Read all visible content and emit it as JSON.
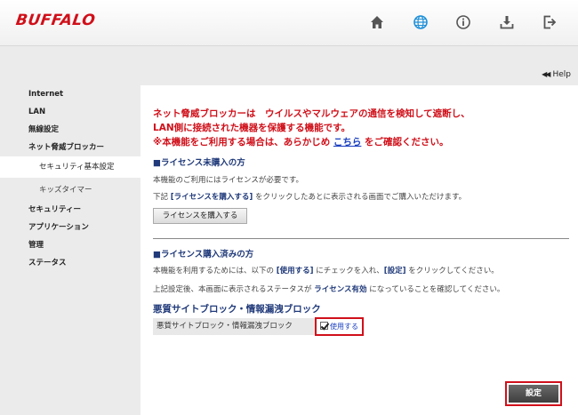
{
  "header": {
    "logo": "BUFFALO",
    "icons": [
      "home-icon",
      "globe-icon",
      "info-icon",
      "download-icon",
      "logout-icon"
    ],
    "help_label": "Help"
  },
  "sidebar": {
    "items": [
      {
        "label": "Internet"
      },
      {
        "label": "LAN"
      },
      {
        "label": "無線設定"
      },
      {
        "label": "ネット脅威ブロッカー"
      },
      {
        "label": "セキュリティ基本設定"
      },
      {
        "label": "キッズタイマー"
      },
      {
        "label": "セキュリティー"
      },
      {
        "label": "アプリケーション"
      },
      {
        "label": "管理"
      },
      {
        "label": "ステータス"
      }
    ]
  },
  "main": {
    "warning_line1": "ネット脅威ブロッカーは　ウイルスやマルウェアの通信を検知して遮断し、",
    "warning_line2": "LAN側に接続された機器を保護する機能です。",
    "warning_line3_pre": "※本機能をご利用する場合は、あらかじめ ",
    "warning_link": "こちら",
    "warning_line3_post": " をご確認ください。",
    "unpurchased_title": "■ライセンス未購入の方",
    "unpurchased_text1": "本機能のご利用にはライセンスが必要です。",
    "unpurchased_text2_pre": "下記 ",
    "unpurchased_text2_bold": "[ライセンスを購入する]",
    "unpurchased_text2_post": " をクリックしたあとに表示される画面でご購入いただけます。",
    "buy_button": "ライセンスを購入する",
    "purchased_title": "■ライセンス購入済みの方",
    "purchased_text1_pre": "本機能を利用するためには、以下の ",
    "purchased_text1_bold1": "[使用する]",
    "purchased_text1_mid": " にチェックを入れ、",
    "purchased_text1_bold2": "[設定]",
    "purchased_text1_post": " をクリックしてください。",
    "purchased_text2_pre": "上記設定後、本画面に表示されるステータスが ",
    "purchased_text2_bold": "ライセンス有効",
    "purchased_text2_post": " になっていることを確認してください。",
    "block_title": "悪質サイトブロック・情報漏洩ブロック",
    "row_label": "悪質サイトブロック・情報漏洩ブロック",
    "use_checkbox_label": "使用する",
    "use_checked": true,
    "submit_button": "設定"
  },
  "colors": {
    "brand": "#d0101a",
    "link": "#1a3fbf",
    "heading": "#203a7a",
    "globe_active": "#1e90d8"
  }
}
